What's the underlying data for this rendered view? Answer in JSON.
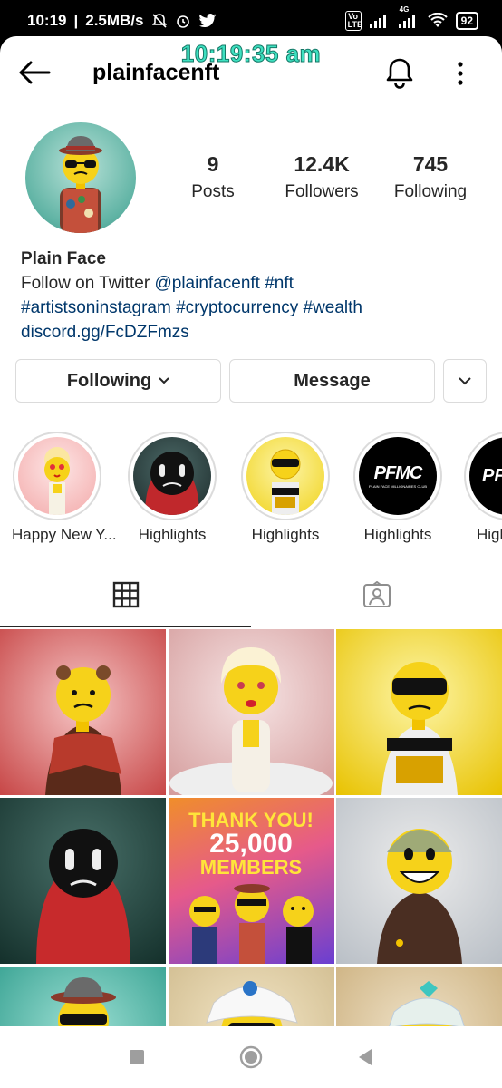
{
  "status_bar": {
    "time": "10:19",
    "speed": "2.5MB/s",
    "battery": "92",
    "volte": "Vo LTE",
    "network": "4G"
  },
  "overlay_clock": "10:19:35 am",
  "header": {
    "username": "plainfacenft"
  },
  "stats": {
    "posts_value": "9",
    "posts_label": "Posts",
    "followers_value": "12.4K",
    "followers_label": "Followers",
    "following_value": "745",
    "following_label": "Following"
  },
  "bio": {
    "name": "Plain Face",
    "line1_text": "Follow on Twitter ",
    "line1_handle": "@plainfacenft",
    "line1_tag": " #nft",
    "line2": "#artistsoninstagram #cryptocurrency #wealth",
    "link": "discord.gg/FcDZFmzs"
  },
  "buttons": {
    "following": "Following",
    "message": "Message"
  },
  "highlights": [
    {
      "label": "Happy New Y..."
    },
    {
      "label": "Highlights"
    },
    {
      "label": "Highlights"
    },
    {
      "label": "Highlights"
    },
    {
      "label": "High"
    }
  ],
  "highlight_logo_text": "PFMC",
  "highlight_logo_sub": "PLAIN FACE MILLIONAIRES CLUB",
  "post_banner": {
    "line1": "THANK YOU!",
    "line2": "25,000",
    "line3": "MEMBERS"
  },
  "icons": {
    "back": "arrow-left-icon",
    "bell": "bell-icon",
    "more": "more-vertical-icon",
    "grid": "grid-icon",
    "tagged": "tagged-person-icon",
    "chevron": "chevron-down-icon"
  },
  "colors": {
    "link": "#00376b",
    "text": "#262626",
    "border": "#dbdbdb",
    "overlay": "#3ee0c0"
  }
}
